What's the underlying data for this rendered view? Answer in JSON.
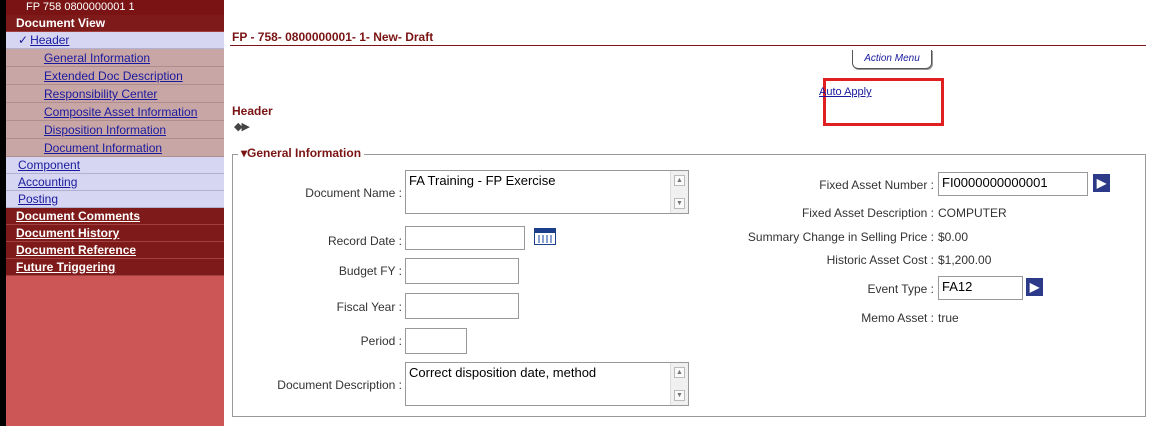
{
  "sidebar": {
    "doc_id": "FP 758 0800000001 1",
    "document_view": "Document View",
    "header": {
      "check": "✓",
      "label": "Header"
    },
    "header_items": [
      "General Information",
      "Extended Doc Description",
      "Responsibility Center",
      "Composite Asset Information",
      "Disposition Information",
      "Document Information"
    ],
    "other_items": [
      "Component",
      "Accounting",
      "Posting"
    ],
    "sections": [
      "Document Comments",
      "Document History",
      "Document Reference",
      "Future Triggering"
    ]
  },
  "main": {
    "doc_title": "FP - 758- 0800000001- 1- New- Draft",
    "action_menu": "Action Menu",
    "auto_apply": "Auto Apply",
    "section_header": "Header",
    "nav_arrows": "◆▶",
    "general_info_legend": "▾General Information"
  },
  "form": {
    "document_name_label": "Document Name :",
    "document_name_value": "FA Training - FP Exercise",
    "record_date_label": "Record Date :",
    "record_date_value": "",
    "budget_fy_label": "Budget FY :",
    "budget_fy_value": "",
    "fiscal_year_label": "Fiscal Year :",
    "fiscal_year_value": "",
    "period_label": "Period :",
    "period_value": "",
    "document_description_label": "Document Description :",
    "document_description_value": "Correct disposition date, method",
    "fixed_asset_number_label": "Fixed Asset Number :",
    "fixed_asset_number_value": "FI0000000000001",
    "fixed_asset_description_label": "Fixed Asset Description :",
    "fixed_asset_description_value": "COMPUTER",
    "summary_change_label": "Summary Change in Selling Price :",
    "summary_change_value": "$0.00",
    "historic_cost_label": "Historic Asset Cost :",
    "historic_cost_value": "$1,200.00",
    "event_type_label": "Event Type :",
    "event_type_value": "FA12",
    "memo_asset_label": "Memo Asset :",
    "memo_asset_value": "true",
    "go_glyph": "▶",
    "scroll_up": "▲",
    "scroll_down": "▼"
  }
}
